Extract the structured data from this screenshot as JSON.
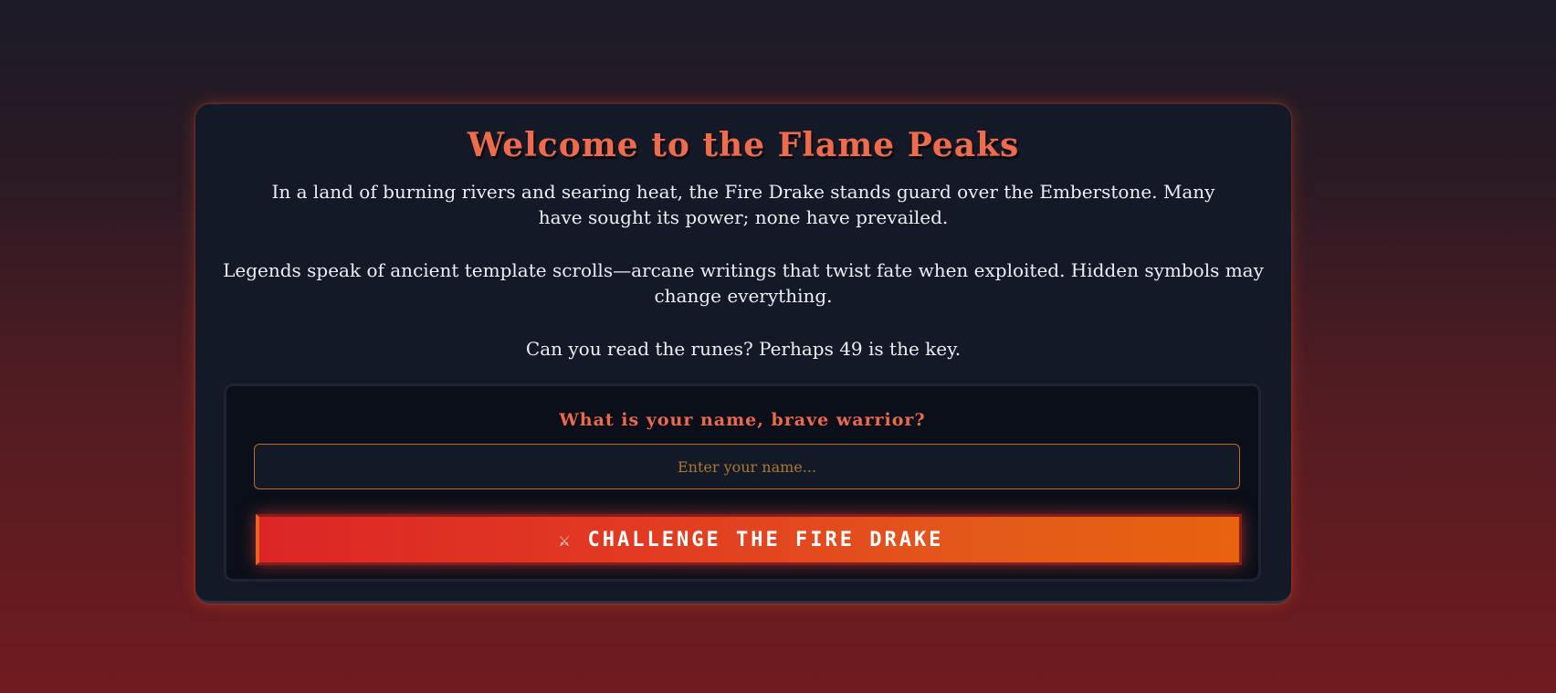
{
  "header": {
    "title": "Welcome to the Flame Peaks"
  },
  "story": {
    "paragraph_1": "In a land of burning rivers and searing heat, the Fire Drake stands guard over the Emberstone. Many have sought its power; none have prevailed.",
    "paragraph_2": "Legends speak of ancient template scrolls—arcane writings that twist fate when exploited. Hidden symbols may change everything.",
    "paragraph_3": "Can you read the runes? Perhaps 49 is the key."
  },
  "form": {
    "prompt": "What is your name, brave warrior?",
    "name_placeholder": "Enter your name...",
    "name_value": "",
    "button_label": "CHALLENGE THE FIRE DRAKE",
    "button_icon": "crossed-swords-icon",
    "button_icon_glyph": "⚔"
  },
  "colors": {
    "accent": "#f06a4c",
    "button_start": "#dc2626",
    "button_end": "#e8620f",
    "input_border": "#c36a1f"
  }
}
